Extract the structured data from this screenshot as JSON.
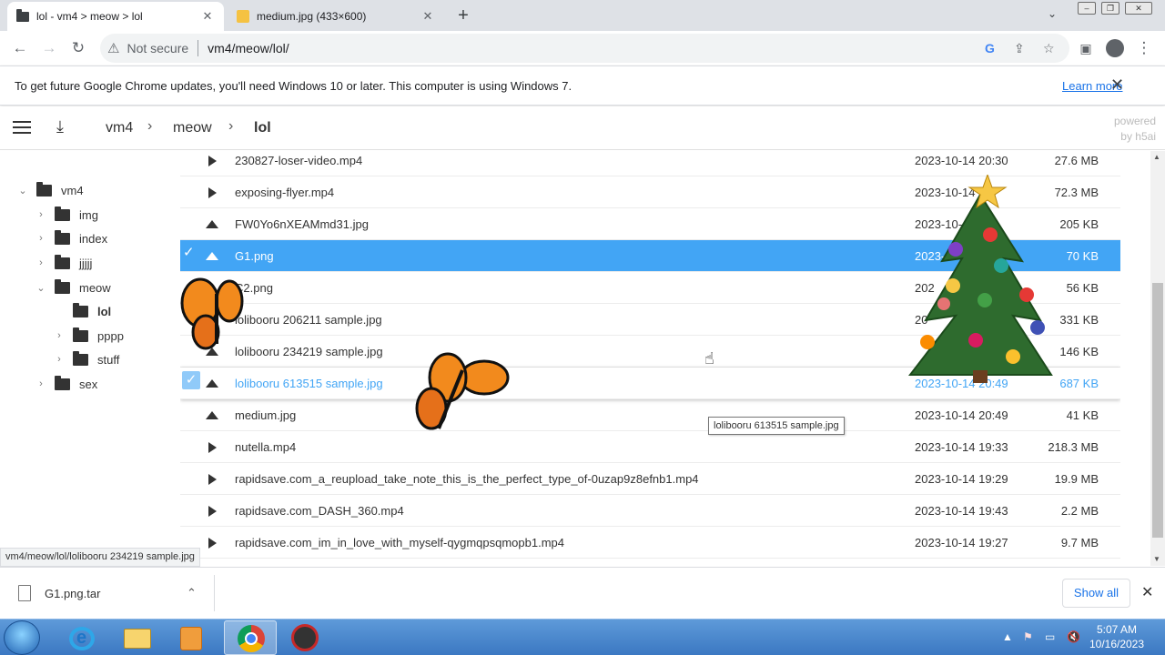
{
  "browser": {
    "tabs": [
      {
        "title": "lol - vm4 > meow > lol",
        "active": true
      },
      {
        "title": "medium.jpg (433×600)",
        "active": false
      }
    ],
    "new_tab": "+",
    "address": {
      "security_label": "Not secure",
      "url": "vm4/meow/lol/"
    },
    "infobar": {
      "message": "To get future Google Chrome updates, you'll need Windows 10 or later. This computer is using Windows 7.",
      "link": "Learn more"
    }
  },
  "app": {
    "breadcrumb": [
      "vm4",
      "meow",
      "lol"
    ],
    "powered_by": [
      "powered",
      "by h5ai"
    ],
    "tree": [
      {
        "label": "vm4",
        "level": 0,
        "expanded": true
      },
      {
        "label": "img",
        "level": 1
      },
      {
        "label": "index",
        "level": 1
      },
      {
        "label": "jjjjj",
        "level": 1
      },
      {
        "label": "meow",
        "level": 1,
        "expanded": true
      },
      {
        "label": "lol",
        "level": 2,
        "current": true
      },
      {
        "label": "pppp",
        "level": 2
      },
      {
        "label": "stuff",
        "level": 2
      },
      {
        "label": "sex",
        "level": 1
      }
    ],
    "files": [
      {
        "name": "230827-loser-video.mp4",
        "type": "video",
        "date": "2023-10-14 20:30",
        "size": "27.6 MB"
      },
      {
        "name": "exposing-flyer.mp4",
        "type": "video",
        "date": "2023-10-14",
        "size": "72.3 MB"
      },
      {
        "name": "FW0Yo6nXEAMmd31.jpg",
        "type": "image",
        "date": "2023-10-",
        "size": "205 KB"
      },
      {
        "name": "G1.png",
        "type": "image",
        "date": "2023-",
        "size": "70 KB",
        "selected": true
      },
      {
        "name": "C2.png",
        "type": "image",
        "date": "202",
        "size": "56 KB"
      },
      {
        "name": "lolibooru 206211 sample.jpg",
        "type": "image",
        "date": "20",
        "size": "331 KB"
      },
      {
        "name": "lolibooru 234219 sample.jpg",
        "type": "image",
        "date": "",
        "size": "146 KB"
      },
      {
        "name": "lolibooru 613515 sample.jpg",
        "type": "image",
        "date": "2023-10-14 20:49",
        "size": "687 KB",
        "focused": true
      },
      {
        "name": "medium.jpg",
        "type": "image",
        "date": "2023-10-14 20:49",
        "size": "41 KB"
      },
      {
        "name": "nutella.mp4",
        "type": "video",
        "date": "2023-10-14 19:33",
        "size": "218.3 MB"
      },
      {
        "name": "rapidsave.com_a_reupload_take_note_this_is_the_perfect_type_of-0uzap9z8efnb1.mp4",
        "type": "video",
        "date": "2023-10-14 19:29",
        "size": "19.9 MB"
      },
      {
        "name": "rapidsave.com_DASH_360.mp4",
        "type": "video",
        "date": "2023-10-14 19:43",
        "size": "2.2 MB"
      },
      {
        "name": "rapidsave.com_im_in_love_with_myself-qygmqpsqmopb1.mp4",
        "type": "video",
        "date": "2023-10-14 19:27",
        "size": "9.7 MB"
      }
    ],
    "tooltip": "lolibooru 613515 sample.jpg",
    "status_url": "vm4/meow/lol/lolibooru 234219 sample.jpg"
  },
  "downloads": {
    "file": "G1.png.tar",
    "show_all": "Show all"
  },
  "taskbar": {
    "time": "5:07 AM",
    "date": "10/16/2023"
  },
  "colors": {
    "selection": "#42a5f5",
    "link": "#1a73e8"
  }
}
